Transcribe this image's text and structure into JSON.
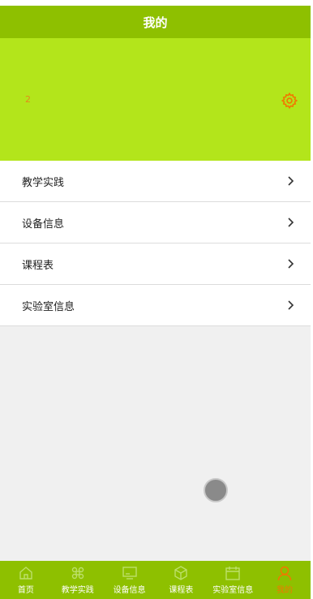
{
  "header": {
    "title": "我的"
  },
  "profile": {
    "user_id": "2",
    "settings_icon": "gear-icon"
  },
  "menu": {
    "items": [
      {
        "label": "教学实践",
        "icon": "chevron-right-icon"
      },
      {
        "label": "设备信息",
        "icon": "chevron-right-icon"
      },
      {
        "label": "课程表",
        "icon": "chevron-right-icon"
      },
      {
        "label": "实验室信息",
        "icon": "chevron-right-icon"
      }
    ]
  },
  "tabbar": {
    "items": [
      {
        "label": "首页",
        "icon": "home-icon"
      },
      {
        "label": "教学实践",
        "icon": "command-icon"
      },
      {
        "label": "设备信息",
        "icon": "monitor-icon"
      },
      {
        "label": "课程表",
        "icon": "cube-icon"
      },
      {
        "label": "实验室信息",
        "icon": "calendar-icon"
      },
      {
        "label": "我的",
        "icon": "user-icon"
      }
    ],
    "active_index": 5
  },
  "colors": {
    "header_bg": "#8ec000",
    "profile_bg": "#b3e51b",
    "accent": "#f07800",
    "page_bg": "#f0f0f0"
  }
}
